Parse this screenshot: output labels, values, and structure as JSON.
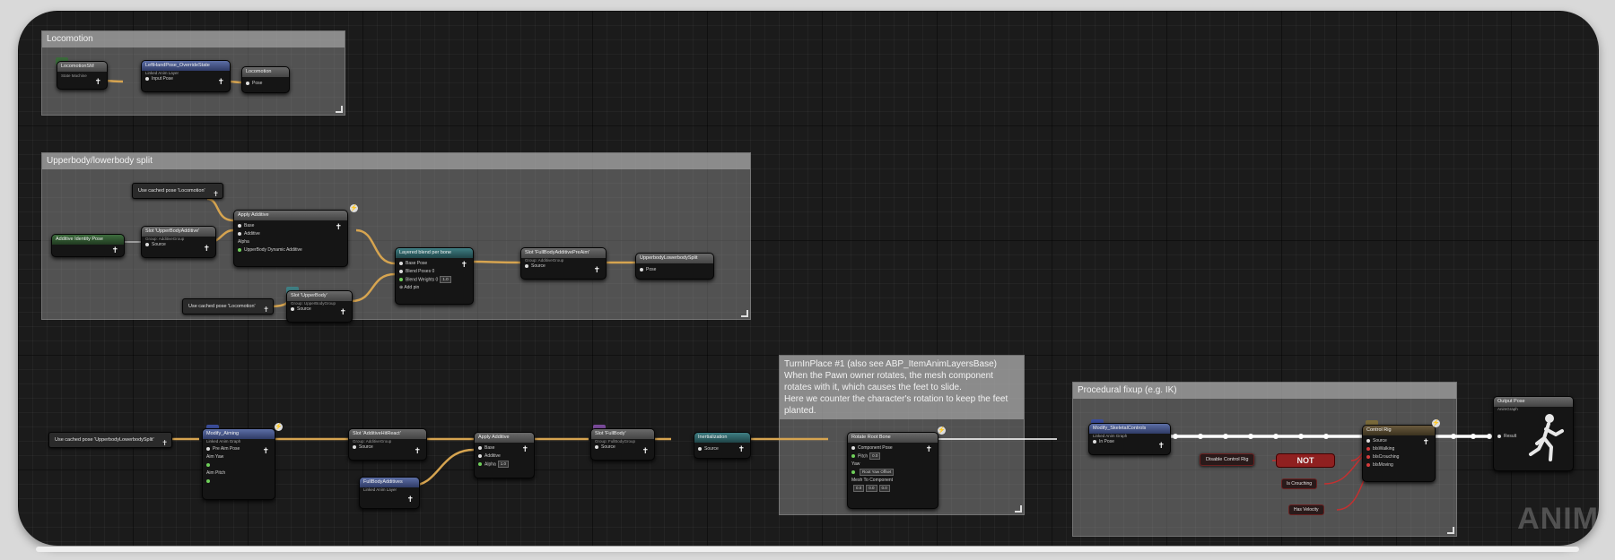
{
  "comments": {
    "locomotion": "Locomotion",
    "upper_lower": "Upperbody/lowerbody split",
    "turn_in_place": "TurnInPlace #1 (also see ABP_ItemAnimLayersBase)\nWhen the Pawn owner rotates, the mesh component rotates with it, which causes the feet to slide.\nHere we counter the character's rotation to keep the feet planted.",
    "procedural": "Procedural fixup (e.g. IK)"
  },
  "nodes": {
    "locomotion_sm": {
      "title": "LocomotionSM",
      "subtitle": "State Machine"
    },
    "left_hand_override": {
      "title": "LeftHandPose_OverrideState",
      "subtitle": "Linked Anim Layer",
      "pin": "Input Pose"
    },
    "cache_locomotion": {
      "title": "Locomotion",
      "pin": "Pose"
    },
    "use_cached_1": {
      "title": "Use cached pose 'Locomotion'"
    },
    "use_cached_2": {
      "title": "Use cached pose 'Locomotion'"
    },
    "additive_identity": {
      "title": "Additive Identity Pose"
    },
    "slot_upper_additive": {
      "title": "Slot 'UpperBodyAdditive'",
      "subtitle": "Group: AdditiveGroup",
      "pin": "Source"
    },
    "apply_additive": {
      "title": "Apply Additive",
      "pins": [
        "Base",
        "Additive"
      ],
      "alpha_label": "Alpha",
      "alpha_value": "UpperBody Dynamic Additive"
    },
    "slot_upperbody": {
      "title": "Slot 'UpperBody'",
      "subtitle": "Group: UpperBodyGroup",
      "pin": "Source"
    },
    "layered_blend": {
      "title": "Layered blend per bone",
      "pins": [
        "Base Pose",
        "Blend Poses 0"
      ],
      "weight_label": "Blend Weights 0",
      "weight_value": "1.0",
      "add_pin": "Add pin"
    },
    "slot_fullbody_additive_preaim": {
      "title": "Slot 'FullBodyAdditivePreAim'",
      "subtitle": "Group: AdditiveGroup",
      "pin": "Source"
    },
    "cache_upper_lower": {
      "title": "UpperbodyLowerbodySplit",
      "pin": "Pose"
    },
    "use_cached_split": {
      "title": "Use cached pose 'UpperbodyLowerbodySplit'"
    },
    "modify_aim": {
      "title": "Modify_Aiming",
      "subtitle": "Linked Anim Graph",
      "pins": [
        "Pre Aim Pose",
        "Aim Yaw",
        "Aim Pitch"
      ]
    },
    "slot_additive_hit": {
      "title": "Slot 'AdditiveHitReact'",
      "subtitle": "Group: AdditiveGroup",
      "pin": "Source"
    },
    "fullbody_additives": {
      "title": "FullBodyAdditives",
      "subtitle": "Linked Anim Layer"
    },
    "apply_additive_2": {
      "title": "Apply Additive",
      "pins": [
        "Base",
        "Additive"
      ],
      "alpha_label": "Alpha",
      "alpha_value": "1.0"
    },
    "slot_fullbody": {
      "title": "Slot 'FullBody'",
      "subtitle": "Group: FullBodyGroup",
      "pin": "Source"
    },
    "inertialization": {
      "title": "Inertialization",
      "pin": "Source"
    },
    "rotate_root": {
      "title": "Rotate Root Bone",
      "pins": [
        "Component Pose",
        "Pitch",
        "Yaw"
      ],
      "pitch_value": "0.0",
      "yaw_value": "Root Yaw Offset",
      "mesh_label": "Mesh To Component",
      "mesh_values": [
        "0.0",
        "0.0",
        "0.0"
      ]
    },
    "skeletal_controls": {
      "title": "Modify_SkeletalControls",
      "subtitle": "Linked Anim Graph",
      "pin": "In Pose"
    },
    "control_rig": {
      "title": "Control Rig",
      "pins": [
        "Source",
        "bIsWalking",
        "bIsCrouching",
        "bIsMoving"
      ]
    },
    "disable_control_rig": {
      "title": "Disable Control Rig"
    },
    "not": {
      "title": "NOT"
    },
    "is_crouching": {
      "title": "Is Crouching"
    },
    "has_velocity": {
      "title": "Has Velocity"
    },
    "output_pose": {
      "title": "Output Pose",
      "subtitle": "AnimGraph",
      "pin": "Result"
    }
  },
  "watermark": "ANIM",
  "colors": {
    "pose_wire": "#d6a450",
    "white_wire": "#ffffff",
    "red_wire": "#c43030",
    "green_pin": "#6fcf5a"
  }
}
